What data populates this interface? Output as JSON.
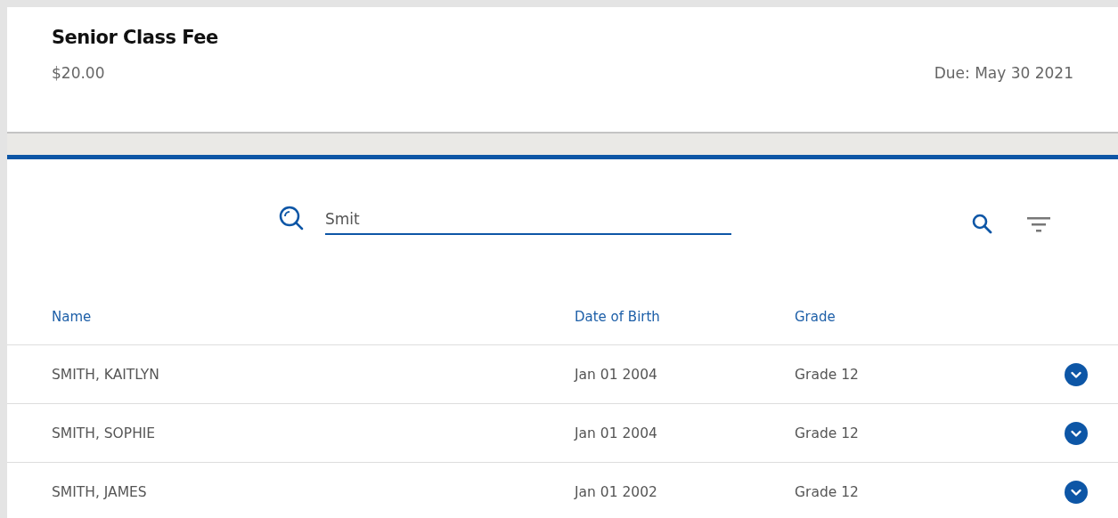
{
  "fee": {
    "title": "Senior Class Fee",
    "amount": "$20.00",
    "due": "Due: May 30 2021"
  },
  "search": {
    "value": "Smit"
  },
  "table": {
    "columns": [
      "Name",
      "Date of Birth",
      "Grade"
    ],
    "rows": [
      {
        "name": "SMITH, KAITLYN",
        "dob": "Jan 01 2004",
        "grade": "Grade 12"
      },
      {
        "name": "SMITH, SOPHIE",
        "dob": "Jan 01 2004",
        "grade": "Grade 12"
      },
      {
        "name": "SMITH, JAMES",
        "dob": "Jan 01 2002",
        "grade": "Grade 12"
      }
    ]
  }
}
